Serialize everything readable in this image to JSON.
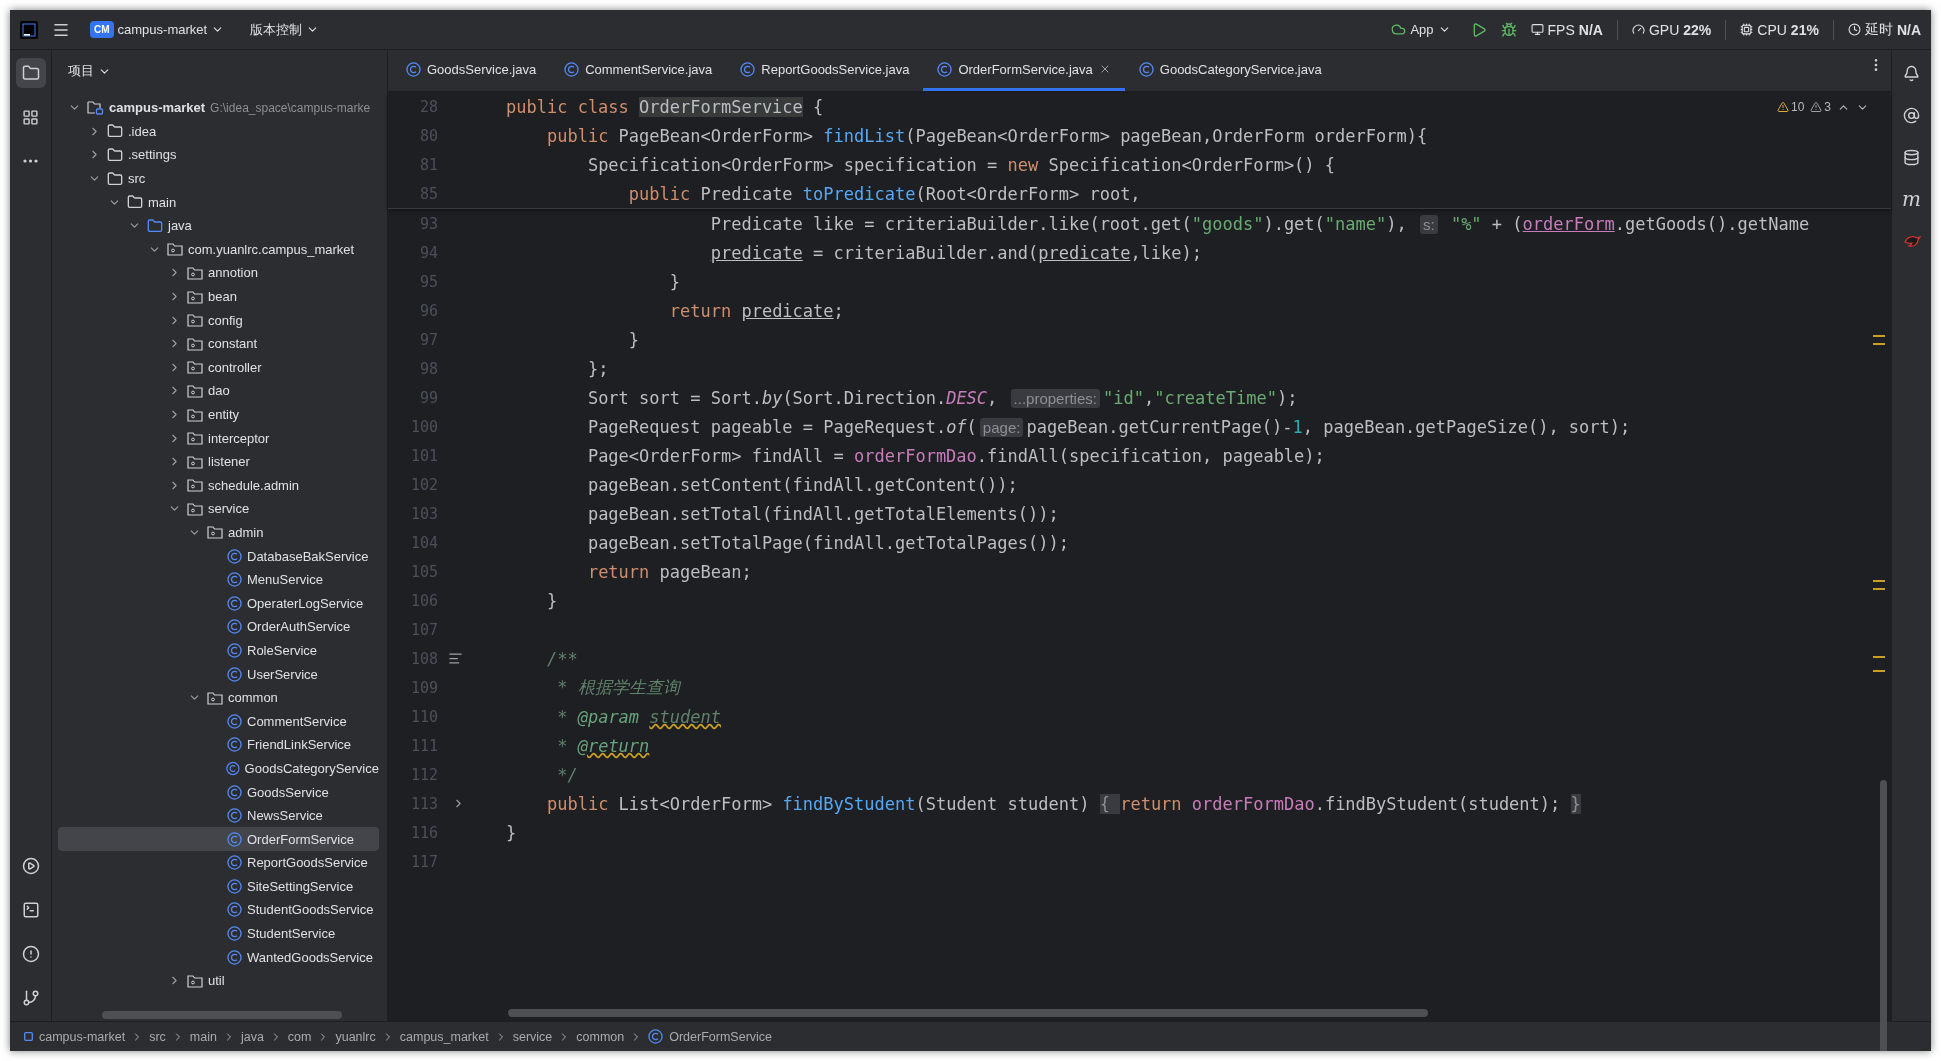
{
  "title_bar": {
    "project_badge": "CM",
    "project": "campus-market",
    "vcs": "版本控制",
    "run_config": "App",
    "monitors": [
      {
        "kind": "fps",
        "label": "FPS",
        "value": "N/A"
      },
      {
        "kind": "gpu",
        "label": "GPU",
        "value": "22%"
      },
      {
        "kind": "cpu",
        "label": "CPU",
        "value": "21%"
      },
      {
        "kind": "latency",
        "label": "延时",
        "value": "N/A"
      }
    ]
  },
  "project_panel": {
    "title": "项目",
    "tree": [
      {
        "label": "campus-market",
        "kind": "module",
        "path": "G:\\idea_space\\campus-marke",
        "expanded": true,
        "selected": false,
        "children": [
          {
            "label": ".idea",
            "kind": "folder",
            "expanded": false,
            "selected": false
          },
          {
            "label": ".settings",
            "kind": "folder",
            "expanded": false,
            "selected": false
          },
          {
            "label": "src",
            "kind": "folder",
            "expanded": true,
            "selected": false,
            "children": [
              {
                "label": "main",
                "kind": "folder",
                "expanded": true,
                "selected": false,
                "children": [
                  {
                    "label": "java",
                    "kind": "source",
                    "expanded": true,
                    "selected": false,
                    "children": [
                      {
                        "label": "com.yuanlrc.campus_market",
                        "kind": "package",
                        "expanded": true,
                        "selected": false,
                        "children": [
                          {
                            "label": "annotion",
                            "kind": "package",
                            "expanded": false,
                            "selected": false
                          },
                          {
                            "label": "bean",
                            "kind": "package",
                            "expanded": false,
                            "selected": false
                          },
                          {
                            "label": "config",
                            "kind": "package",
                            "expanded": false,
                            "selected": false
                          },
                          {
                            "label": "constant",
                            "kind": "package",
                            "expanded": false,
                            "selected": false
                          },
                          {
                            "label": "controller",
                            "kind": "package",
                            "expanded": false,
                            "selected": false
                          },
                          {
                            "label": "dao",
                            "kind": "package",
                            "expanded": false,
                            "selected": false
                          },
                          {
                            "label": "entity",
                            "kind": "package",
                            "expanded": false,
                            "selected": false
                          },
                          {
                            "label": "interceptor",
                            "kind": "package",
                            "expanded": false,
                            "selected": false
                          },
                          {
                            "label": "listener",
                            "kind": "package",
                            "expanded": false,
                            "selected": false
                          },
                          {
                            "label": "schedule.admin",
                            "kind": "package",
                            "expanded": false,
                            "selected": false
                          },
                          {
                            "label": "service",
                            "kind": "package",
                            "expanded": true,
                            "selected": false,
                            "children": [
                              {
                                "label": "admin",
                                "kind": "package",
                                "expanded": true,
                                "selected": false,
                                "children": [
                                  {
                                    "label": "DatabaseBakService",
                                    "kind": "class",
                                    "selected": false
                                  },
                                  {
                                    "label": "MenuService",
                                    "kind": "class",
                                    "selected": false
                                  },
                                  {
                                    "label": "OperaterLogService",
                                    "kind": "class",
                                    "selected": false
                                  },
                                  {
                                    "label": "OrderAuthService",
                                    "kind": "class",
                                    "selected": false
                                  },
                                  {
                                    "label": "RoleService",
                                    "kind": "class",
                                    "selected": false
                                  },
                                  {
                                    "label": "UserService",
                                    "kind": "class",
                                    "selected": false
                                  }
                                ]
                              },
                              {
                                "label": "common",
                                "kind": "package",
                                "expanded": true,
                                "selected": false,
                                "children": [
                                  {
                                    "label": "CommentService",
                                    "kind": "class",
                                    "selected": false
                                  },
                                  {
                                    "label": "FriendLinkService",
                                    "kind": "class",
                                    "selected": false
                                  },
                                  {
                                    "label": "GoodsCategoryService",
                                    "kind": "class",
                                    "selected": false
                                  },
                                  {
                                    "label": "GoodsService",
                                    "kind": "class",
                                    "selected": false
                                  },
                                  {
                                    "label": "NewsService",
                                    "kind": "class",
                                    "selected": false
                                  },
                                  {
                                    "label": "OrderFormService",
                                    "kind": "class",
                                    "selected": true
                                  },
                                  {
                                    "label": "ReportGoodsService",
                                    "kind": "class",
                                    "selected": false
                                  },
                                  {
                                    "label": "SiteSettingService",
                                    "kind": "class",
                                    "selected": false
                                  },
                                  {
                                    "label": "StudentGoodsService",
                                    "kind": "class",
                                    "selected": false
                                  },
                                  {
                                    "label": "StudentService",
                                    "kind": "class",
                                    "selected": false
                                  },
                                  {
                                    "label": "WantedGoodsService",
                                    "kind": "class",
                                    "selected": false
                                  }
                                ]
                              }
                            ]
                          },
                          {
                            "label": "util",
                            "kind": "package",
                            "expanded": false,
                            "selected": false
                          }
                        ]
                      }
                    ]
                  }
                ]
              }
            ]
          }
        ]
      }
    ]
  },
  "tabs": [
    {
      "label": "GoodsService.java",
      "selected": false
    },
    {
      "label": "CommentService.java",
      "selected": false
    },
    {
      "label": "ReportGoodsService.java",
      "selected": false
    },
    {
      "label": "OrderFormService.java",
      "selected": true
    },
    {
      "label": "GoodsCategoryService.java",
      "selected": false
    }
  ],
  "inspections": {
    "warnings": "10",
    "weak_warnings": "3"
  },
  "right_strip": {
    "maven_label": "m"
  },
  "sticky_lines": [
    {
      "number": "28",
      "tokens": [
        {
          "text": "public class ",
          "kind": "kw"
        },
        {
          "text": "OrderFormService",
          "kind": "mark"
        },
        {
          "text": " {",
          "kind": "plain"
        }
      ]
    },
    {
      "number": "80",
      "tokens": [
        {
          "text": "    public ",
          "kind": "kw"
        },
        {
          "text": "PageBean<OrderForm> ",
          "kind": "plain"
        },
        {
          "text": "findList",
          "kind": "decl"
        },
        {
          "text": "(PageBean<OrderForm> pageBean,OrderForm orderForm){",
          "kind": "plain"
        }
      ]
    },
    {
      "number": "81",
      "tokens": [
        {
          "text": "        Specification<OrderForm> specification = ",
          "kind": "plain"
        },
        {
          "text": "new ",
          "kind": "kw"
        },
        {
          "text": "Specification<OrderForm>() {",
          "kind": "plain"
        }
      ]
    },
    {
      "number": "85",
      "tokens": [
        {
          "text": "            public ",
          "kind": "kw"
        },
        {
          "text": "Predicate ",
          "kind": "plain"
        },
        {
          "text": "toPredicate",
          "kind": "decl"
        },
        {
          "text": "(Root<OrderForm> root,",
          "kind": "plain"
        }
      ]
    }
  ],
  "lines": [
    {
      "number": "93",
      "tokens": [
        {
          "text": "                    Predicate like = criteriaBuilder.like(root.get(",
          "kind": "plain"
        },
        {
          "text": "\"goods\"",
          "kind": "str"
        },
        {
          "text": ").get(",
          "kind": "plain"
        },
        {
          "text": "\"name\"",
          "kind": "str"
        },
        {
          "text": "), ",
          "kind": "plain"
        },
        {
          "text": "s:",
          "kind": "hint"
        },
        {
          "text": " \"%\"",
          "kind": "str"
        },
        {
          "text": " + (",
          "kind": "plain"
        },
        {
          "text": "orderForm",
          "kind": "param"
        },
        {
          "text": ".getGoods().getName",
          "kind": "plain"
        }
      ]
    },
    {
      "number": "94",
      "tokens": [
        {
          "text": "                    predicate",
          "kind": "local"
        },
        {
          "text": " = criteriaBuilder.and(",
          "kind": "plain"
        },
        {
          "text": "predicate",
          "kind": "local"
        },
        {
          "text": ",like);",
          "kind": "plain"
        }
      ]
    },
    {
      "number": "95",
      "tokens": [
        {
          "text": "                }",
          "kind": "plain"
        }
      ]
    },
    {
      "number": "96",
      "tokens": [
        {
          "text": "                return ",
          "kind": "kw"
        },
        {
          "text": "predicate",
          "kind": "local"
        },
        {
          "text": ";",
          "kind": "plain"
        }
      ]
    },
    {
      "number": "97",
      "tokens": [
        {
          "text": "            }",
          "kind": "plain"
        }
      ]
    },
    {
      "number": "98",
      "tokens": [
        {
          "text": "        };",
          "kind": "plain"
        }
      ]
    },
    {
      "number": "99",
      "tokens": [
        {
          "text": "        Sort sort = Sort.",
          "kind": "plain"
        },
        {
          "text": "by",
          "kind": "italic"
        },
        {
          "text": "(Sort.Direction.",
          "kind": "plain"
        },
        {
          "text": "DESC",
          "kind": "static"
        },
        {
          "text": ", ",
          "kind": "plain"
        },
        {
          "text": "...properties:",
          "kind": "hint"
        },
        {
          "text": "\"id\"",
          "kind": "str"
        },
        {
          "text": ",",
          "kind": "plain"
        },
        {
          "text": "\"createTime\"",
          "kind": "str"
        },
        {
          "text": ");",
          "kind": "plain"
        }
      ]
    },
    {
      "number": "100",
      "tokens": [
        {
          "text": "        PageRequest pageable = PageRequest.",
          "kind": "plain"
        },
        {
          "text": "of",
          "kind": "italic"
        },
        {
          "text": "(",
          "kind": "plain"
        },
        {
          "text": "page:",
          "kind": "hint"
        },
        {
          "text": "pageBean.getCurrentPage()-",
          "kind": "plain"
        },
        {
          "text": "1",
          "kind": "num"
        },
        {
          "text": ", pageBean.getPageSize(), sort);",
          "kind": "plain"
        }
      ]
    },
    {
      "number": "101",
      "tokens": [
        {
          "text": "        Page<OrderForm> findAll = ",
          "kind": "plain"
        },
        {
          "text": "orderFormDao",
          "kind": "field"
        },
        {
          "text": ".findAll(specification, pageable);",
          "kind": "plain"
        }
      ]
    },
    {
      "number": "102",
      "tokens": [
        {
          "text": "        pageBean.setContent(findAll.getContent());",
          "kind": "plain"
        }
      ]
    },
    {
      "number": "103",
      "tokens": [
        {
          "text": "        pageBean.setTotal(findAll.getTotalElements());",
          "kind": "plain"
        }
      ]
    },
    {
      "number": "104",
      "tokens": [
        {
          "text": "        pageBean.setTotalPage(findAll.getTotalPages());",
          "kind": "plain"
        }
      ]
    },
    {
      "number": "105",
      "tokens": [
        {
          "text": "        return ",
          "kind": "kw"
        },
        {
          "text": "pageBean;",
          "kind": "plain"
        }
      ]
    },
    {
      "number": "106",
      "tokens": [
        {
          "text": "    }",
          "kind": "plain"
        }
      ]
    },
    {
      "number": "107"
    },
    {
      "number": "108",
      "doc_toggle": true,
      "tokens": [
        {
          "text": "    /**",
          "kind": "doc"
        }
      ]
    },
    {
      "number": "109",
      "tokens": [
        {
          "text": "     * 根据学生查询",
          "kind": "doc"
        }
      ]
    },
    {
      "number": "110",
      "tokens": [
        {
          "text": "     * ",
          "kind": "doc"
        },
        {
          "text": "@param ",
          "kind": "doctag"
        },
        {
          "text": "student",
          "kind": "docwarn"
        }
      ]
    },
    {
      "number": "111",
      "tokens": [
        {
          "text": "     * ",
          "kind": "doc"
        },
        {
          "text": "@return",
          "kind": "doctagwarn"
        }
      ]
    },
    {
      "number": "112",
      "tokens": [
        {
          "text": "     */",
          "kind": "doc"
        }
      ]
    },
    {
      "number": "113",
      "collapsed": true,
      "tokens": [
        {
          "text": "    public ",
          "kind": "kw"
        },
        {
          "text": "List<OrderForm> ",
          "kind": "plain"
        },
        {
          "text": "findByStudent",
          "kind": "decl"
        },
        {
          "text": "(Student student)",
          "kind": "plain"
        },
        {
          "text": " { ",
          "kind": "folded"
        },
        {
          "text": "return ",
          "kind": "kw"
        },
        {
          "text": "orderFormDao",
          "kind": "field"
        },
        {
          "text": ".findByStudent(student);",
          "kind": "plain"
        },
        {
          "text": " }",
          "kind": "folded"
        }
      ]
    },
    {
      "number": "116",
      "tokens": [
        {
          "text": "}",
          "kind": "plain"
        }
      ]
    },
    {
      "number": "117"
    }
  ],
  "breadcrumbs": [
    "campus-market",
    "src",
    "main",
    "java",
    "com",
    "yuanlrc",
    "campus_market",
    "service",
    "common",
    "OrderFormService"
  ]
}
